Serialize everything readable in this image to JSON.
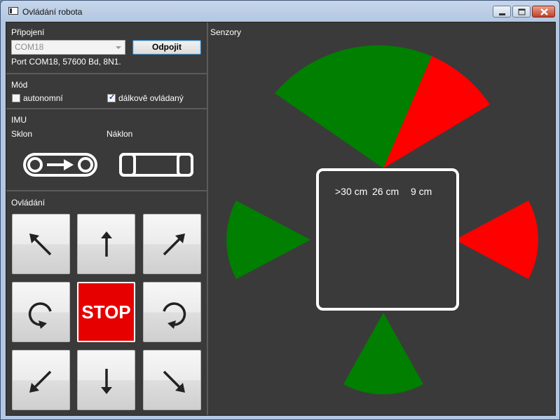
{
  "window": {
    "title": "Ovládání robota",
    "buttons": [
      "minimize",
      "maximize",
      "close"
    ]
  },
  "connection": {
    "heading": "Připojení",
    "port_selected": "COM18",
    "connect_button": "Odpojit",
    "status": "Port COM18, 57600 Bd, 8N1."
  },
  "mode": {
    "heading": "Mód",
    "options": [
      {
        "label": "autonomní",
        "checked": false
      },
      {
        "label": "dálkově ovládaný",
        "checked": true
      }
    ]
  },
  "imu": {
    "heading": "IMU",
    "pitch_label": "Sklon",
    "roll_label": "Náklon"
  },
  "control": {
    "heading": "Ovládání",
    "stop_label": "STOP",
    "buttons": [
      "up-left",
      "up",
      "up-right",
      "rotate-left",
      "stop",
      "rotate-right",
      "down-left",
      "down",
      "down-right"
    ]
  },
  "sensors": {
    "heading": "Senzory",
    "readings": [
      ">30 cm",
      "26 cm",
      "9 cm"
    ],
    "colors": {
      "near": "#ff0000",
      "far": "#007f00",
      "background": "#3a3a3a"
    }
  }
}
